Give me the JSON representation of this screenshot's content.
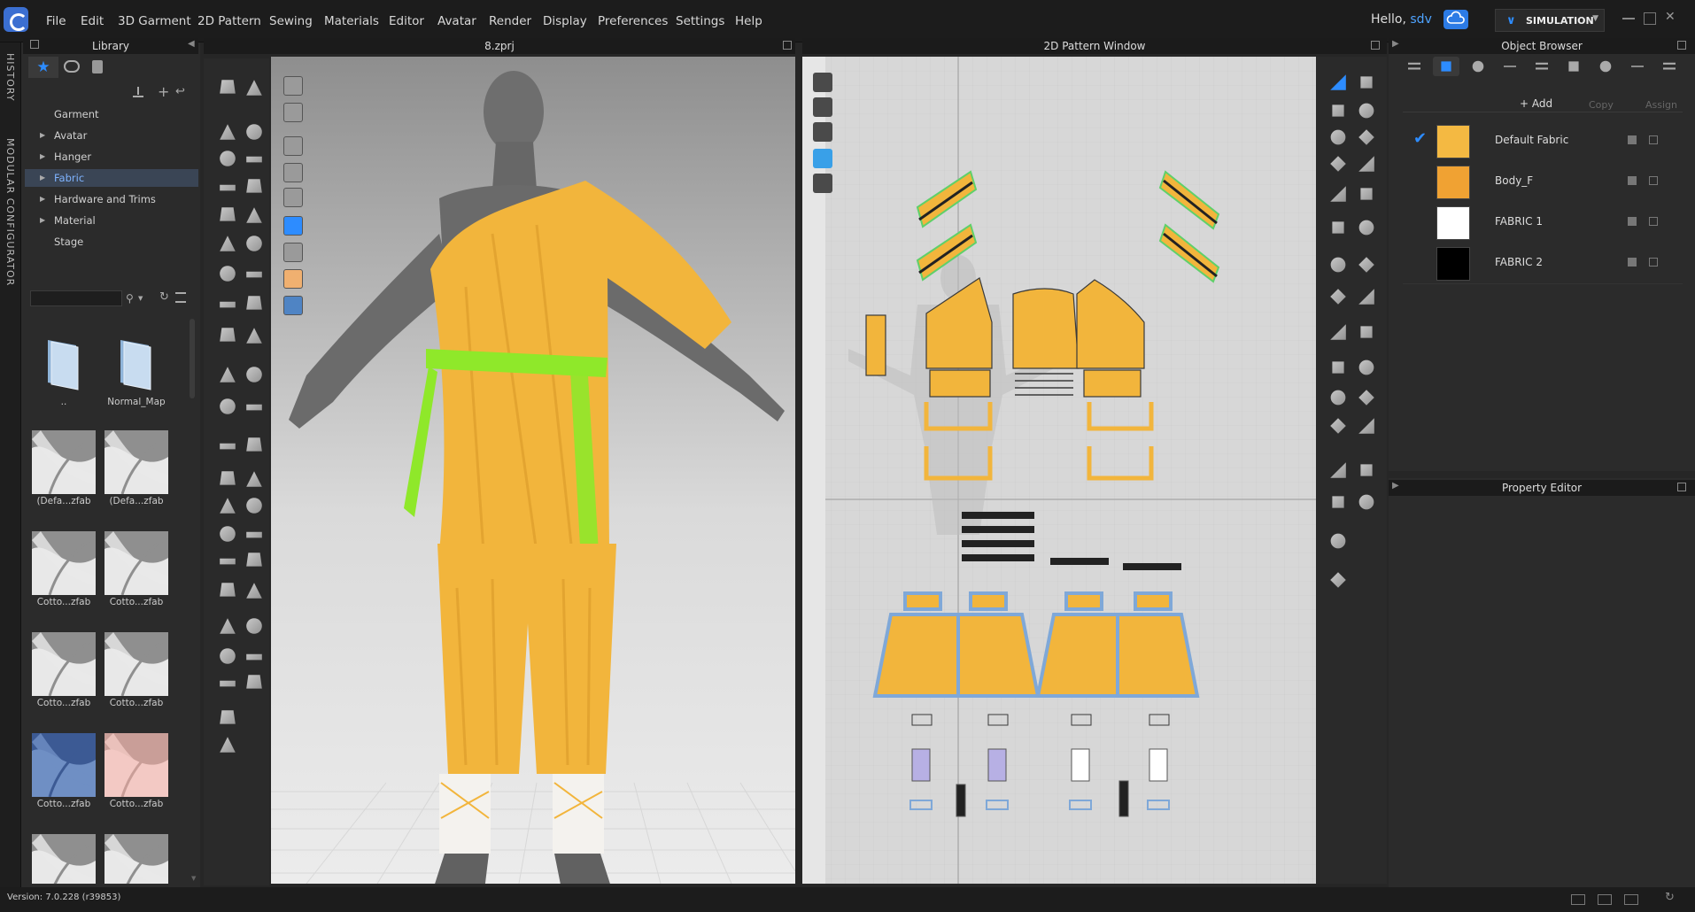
{
  "menu": {
    "items": [
      "File",
      "Edit",
      "3D Garment",
      "2D Pattern",
      "Sewing",
      "Materials",
      "Editor",
      "Avatar",
      "Render",
      "Display",
      "Preferences",
      "Settings",
      "Help"
    ],
    "greeting_prefix": "Hello, ",
    "user": "sdv",
    "mode_label": "SIMULATION"
  },
  "side_tabs": [
    "HISTORY",
    "MODULAR CONFIGURATOR"
  ],
  "library": {
    "title": "Library",
    "tree": [
      {
        "label": "Garment",
        "expandable": false,
        "selected": false
      },
      {
        "label": "Avatar",
        "expandable": true,
        "selected": false
      },
      {
        "label": "Hanger",
        "expandable": true,
        "selected": false
      },
      {
        "label": "Fabric",
        "expandable": true,
        "selected": true
      },
      {
        "label": "Hardware and Trims",
        "expandable": true,
        "selected": false
      },
      {
        "label": "Material",
        "expandable": true,
        "selected": false
      },
      {
        "label": "Stage",
        "expandable": false,
        "selected": false
      }
    ],
    "thumbnails": [
      {
        "label": "..",
        "kind": "folder"
      },
      {
        "label": "Normal_Map",
        "kind": "folder"
      },
      {
        "label": "(Defa...zfab",
        "kind": "fabric-white"
      },
      {
        "label": "(Defa...zfab",
        "kind": "fabric-white"
      },
      {
        "label": "Cotto...zfab",
        "kind": "fabric-white"
      },
      {
        "label": "Cotto...zfab",
        "kind": "fabric-white"
      },
      {
        "label": "Cotto...zfab",
        "kind": "fabric-white"
      },
      {
        "label": "Cotto...zfab",
        "kind": "fabric-white"
      },
      {
        "label": "Cotto...zfab",
        "kind": "fabric-blue"
      },
      {
        "label": "Cotto...zfab",
        "kind": "fabric-pink"
      },
      {
        "label": "",
        "kind": "fabric-white"
      },
      {
        "label": "",
        "kind": "fabric-white"
      }
    ]
  },
  "viewport3d": {
    "title": "8.zprj"
  },
  "pattern2d": {
    "title": "2D Pattern Window"
  },
  "object_browser": {
    "title": "Object Browser",
    "add_label": "+ Add",
    "copy_label": "Copy",
    "assign_label": "Assign",
    "fabrics": [
      {
        "name": "Default Fabric",
        "color": "#f4b942",
        "checked": true
      },
      {
        "name": "Body_F",
        "color": "#f0a233",
        "checked": false
      },
      {
        "name": "FABRIC 1",
        "color": "#ffffff",
        "checked": false
      },
      {
        "name": "FABRIC 2",
        "color": "#000000",
        "checked": false
      }
    ]
  },
  "property_editor": {
    "title": "Property Editor"
  },
  "status": {
    "version": "Version: 7.0.228 (r39853)"
  },
  "colors": {
    "accent": "#2d8cff",
    "garment": "#f2b53c",
    "belt": "#8fe82a",
    "avatar": "#6b6b6b"
  }
}
